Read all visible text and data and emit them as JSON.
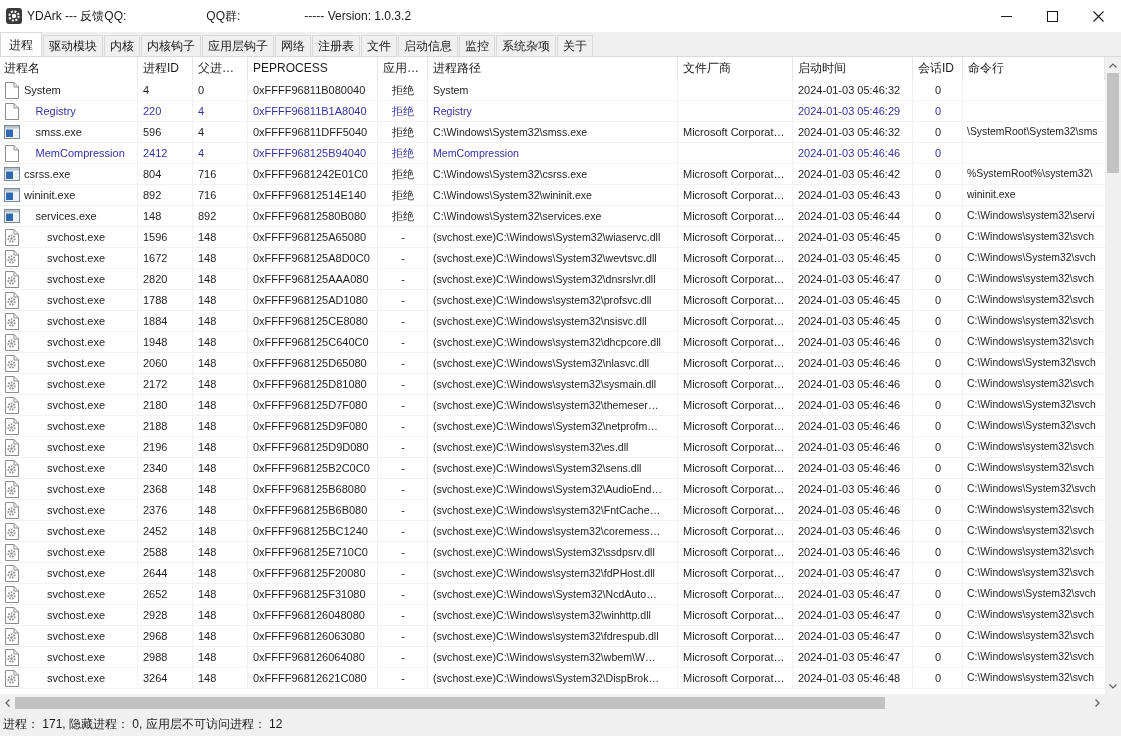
{
  "window": {
    "title_parts": [
      "YDArk --- 反馈QQ:",
      "QQ群:",
      "----- Version: 1.0.3.2"
    ]
  },
  "tabs": [
    {
      "label": "进程",
      "selected": true
    },
    {
      "label": "驱动模块",
      "selected": false
    },
    {
      "label": "内核",
      "selected": false
    },
    {
      "label": "内核钩子",
      "selected": false
    },
    {
      "label": "应用层钩子",
      "selected": false
    },
    {
      "label": "网络",
      "selected": false
    },
    {
      "label": "注册表",
      "selected": false
    },
    {
      "label": "文件",
      "selected": false
    },
    {
      "label": "启动信息",
      "selected": false
    },
    {
      "label": "监控",
      "selected": false
    },
    {
      "label": "系统杂项",
      "selected": false
    },
    {
      "label": "关于",
      "selected": false
    }
  ],
  "table": {
    "columns": [
      "进程名",
      "进程ID",
      "父进…",
      "PEPROCESS",
      "应用…",
      "进程路径",
      "文件厂商",
      "启动时间",
      "会话ID",
      "命令行"
    ],
    "rows": [
      {
        "kind": "file",
        "name": "System",
        "pid": "4",
        "ppid": "0",
        "peprocess": "0xFFFF96811B080040",
        "access": "拒绝",
        "path": "System",
        "start_time": "2024-01-03 05:46:32",
        "session": "0",
        "children": [
          {
            "kind": "file",
            "name": "Registry",
            "pid": "220",
            "ppid": "4",
            "peprocess": "0xFFFF96811B1A8040",
            "access": "拒绝",
            "path": "Registry",
            "start_time": "2024-01-03 05:46:29",
            "session": "0",
            "color": "#3333a0"
          },
          {
            "kind": "exe",
            "name": "smss.exe",
            "pid": "596",
            "ppid": "4",
            "peprocess": "0xFFFF96811DFF5040",
            "access": "拒绝",
            "path": "C:\\Windows\\System32\\smss.exe",
            "vendor": "Microsoft Corporat…",
            "start_time": "2024-01-03 05:46:32",
            "session": "0",
            "cmdline": "\\SystemRoot\\System32\\sms"
          },
          {
            "kind": "file",
            "name": "MemCompression",
            "pid": "2412",
            "ppid": "4",
            "peprocess": "0xFFFF968125B94040",
            "access": "拒绝",
            "path": "MemCompression",
            "start_time": "2024-01-03 05:46:46",
            "session": "0",
            "color": "#3333a0"
          }
        ]
      },
      {
        "kind": "exe",
        "name": "csrss.exe",
        "pid": "804",
        "ppid": "716",
        "peprocess": "0xFFFF9681242E01C0",
        "access": "拒绝",
        "path": "C:\\Windows\\System32\\csrss.exe",
        "vendor": "Microsoft Corporat…",
        "start_time": "2024-01-03 05:46:42",
        "session": "0",
        "cmdline": "%SystemRoot%\\system32\\"
      },
      {
        "kind": "exe",
        "name": "wininit.exe",
        "pid": "892",
        "ppid": "716",
        "peprocess": "0xFFFF96812514E140",
        "access": "拒绝",
        "path": "C:\\Windows\\System32\\wininit.exe",
        "vendor": "Microsoft Corporat…",
        "start_time": "2024-01-03 05:46:43",
        "session": "0",
        "cmdline": "wininit.exe",
        "children": [
          {
            "kind": "exe",
            "name": "services.exe",
            "pid": "148",
            "ppid": "892",
            "peprocess": "0xFFFF96812580B080",
            "access": "拒绝",
            "path": "C:\\Windows\\System32\\services.exe",
            "vendor": "Microsoft Corporat…",
            "start_time": "2024-01-03 05:46:44",
            "session": "0",
            "cmdline": "C:\\Windows\\system32\\servi",
            "children": [
              {
                "kind": "svc",
                "name": "svchost.exe",
                "pid": "1596",
                "ppid": "148",
                "peprocess": "0xFFFF968125A65080",
                "access": "-",
                "path": "(svchost.exe)C:\\Windows\\System32\\wiaservc.dll",
                "vendor": "Microsoft Corporat…",
                "start_time": "2024-01-03 05:46:45",
                "session": "0",
                "cmdline": "C:\\Windows\\system32\\svch"
              },
              {
                "kind": "svc",
                "name": "svchost.exe",
                "pid": "1672",
                "ppid": "148",
                "peprocess": "0xFFFF968125A8D0C0",
                "access": "-",
                "path": "(svchost.exe)C:\\Windows\\System32\\wevtsvc.dll",
                "vendor": "Microsoft Corporat…",
                "start_time": "2024-01-03 05:46:45",
                "session": "0",
                "cmdline": "C:\\Windows\\System32\\svch"
              },
              {
                "kind": "svc",
                "name": "svchost.exe",
                "pid": "2820",
                "ppid": "148",
                "peprocess": "0xFFFF968125AAA080",
                "access": "-",
                "path": "(svchost.exe)C:\\Windows\\System32\\dnsrslvr.dll",
                "vendor": "Microsoft Corporat…",
                "start_time": "2024-01-03 05:46:47",
                "session": "0",
                "cmdline": "C:\\Windows\\system32\\svch"
              },
              {
                "kind": "svc",
                "name": "svchost.exe",
                "pid": "1788",
                "ppid": "148",
                "peprocess": "0xFFFF968125AD1080",
                "access": "-",
                "path": "(svchost.exe)C:\\Windows\\system32\\profsvc.dll",
                "vendor": "Microsoft Corporat…",
                "start_time": "2024-01-03 05:46:45",
                "session": "0",
                "cmdline": "C:\\Windows\\system32\\svch"
              },
              {
                "kind": "svc",
                "name": "svchost.exe",
                "pid": "1884",
                "ppid": "148",
                "peprocess": "0xFFFF968125CE8080",
                "access": "-",
                "path": "(svchost.exe)C:\\Windows\\system32\\nsisvc.dll",
                "vendor": "Microsoft Corporat…",
                "start_time": "2024-01-03 05:46:45",
                "session": "0",
                "cmdline": "C:\\Windows\\system32\\svch"
              },
              {
                "kind": "svc",
                "name": "svchost.exe",
                "pid": "1948",
                "ppid": "148",
                "peprocess": "0xFFFF968125C640C0",
                "access": "-",
                "path": "(svchost.exe)C:\\Windows\\system32\\dhcpcore.dll",
                "vendor": "Microsoft Corporat…",
                "start_time": "2024-01-03 05:46:46",
                "session": "0",
                "cmdline": "C:\\Windows\\system32\\svch"
              },
              {
                "kind": "svc",
                "name": "svchost.exe",
                "pid": "2060",
                "ppid": "148",
                "peprocess": "0xFFFF968125D65080",
                "access": "-",
                "path": "(svchost.exe)C:\\Windows\\System32\\nlasvc.dll",
                "vendor": "Microsoft Corporat…",
                "start_time": "2024-01-03 05:46:46",
                "session": "0",
                "cmdline": "C:\\Windows\\System32\\svch"
              },
              {
                "kind": "svc",
                "name": "svchost.exe",
                "pid": "2172",
                "ppid": "148",
                "peprocess": "0xFFFF968125D81080",
                "access": "-",
                "path": "(svchost.exe)C:\\Windows\\system32\\sysmain.dll",
                "vendor": "Microsoft Corporat…",
                "start_time": "2024-01-03 05:46:46",
                "session": "0",
                "cmdline": "C:\\Windows\\system32\\svch"
              },
              {
                "kind": "svc",
                "name": "svchost.exe",
                "pid": "2180",
                "ppid": "148",
                "peprocess": "0xFFFF968125D7F080",
                "access": "-",
                "path": "(svchost.exe)C:\\Windows\\system32\\themeser…",
                "vendor": "Microsoft Corporat…",
                "start_time": "2024-01-03 05:46:46",
                "session": "0",
                "cmdline": "C:\\Windows\\System32\\svch"
              },
              {
                "kind": "svc",
                "name": "svchost.exe",
                "pid": "2188",
                "ppid": "148",
                "peprocess": "0xFFFF968125D9F080",
                "access": "-",
                "path": "(svchost.exe)C:\\Windows\\System32\\netprofm…",
                "vendor": "Microsoft Corporat…",
                "start_time": "2024-01-03 05:46:46",
                "session": "0",
                "cmdline": "C:\\Windows\\System32\\svch"
              },
              {
                "kind": "svc",
                "name": "svchost.exe",
                "pid": "2196",
                "ppid": "148",
                "peprocess": "0xFFFF968125D9D080",
                "access": "-",
                "path": "(svchost.exe)C:\\Windows\\system32\\es.dll",
                "vendor": "Microsoft Corporat…",
                "start_time": "2024-01-03 05:46:46",
                "session": "0",
                "cmdline": "C:\\Windows\\system32\\svch"
              },
              {
                "kind": "svc",
                "name": "svchost.exe",
                "pid": "2340",
                "ppid": "148",
                "peprocess": "0xFFFF968125B2C0C0",
                "access": "-",
                "path": "(svchost.exe)C:\\Windows\\System32\\sens.dll",
                "vendor": "Microsoft Corporat…",
                "start_time": "2024-01-03 05:46:46",
                "session": "0",
                "cmdline": "C:\\Windows\\system32\\svch"
              },
              {
                "kind": "svc",
                "name": "svchost.exe",
                "pid": "2368",
                "ppid": "148",
                "peprocess": "0xFFFF968125B68080",
                "access": "-",
                "path": "(svchost.exe)C:\\Windows\\System32\\AudioEnd…",
                "vendor": "Microsoft Corporat…",
                "start_time": "2024-01-03 05:46:46",
                "session": "0",
                "cmdline": "C:\\Windows\\System32\\svch"
              },
              {
                "kind": "svc",
                "name": "svchost.exe",
                "pid": "2376",
                "ppid": "148",
                "peprocess": "0xFFFF968125B6B080",
                "access": "-",
                "path": "(svchost.exe)C:\\Windows\\system32\\FntCache…",
                "vendor": "Microsoft Corporat…",
                "start_time": "2024-01-03 05:46:46",
                "session": "0",
                "cmdline": "C:\\Windows\\system32\\svch"
              },
              {
                "kind": "svc",
                "name": "svchost.exe",
                "pid": "2452",
                "ppid": "148",
                "peprocess": "0xFFFF968125BC1240",
                "access": "-",
                "path": "(svchost.exe)C:\\Windows\\system32\\coremess…",
                "vendor": "Microsoft Corporat…",
                "start_time": "2024-01-03 05:46:46",
                "session": "0",
                "cmdline": "C:\\Windows\\system32\\svch"
              },
              {
                "kind": "svc",
                "name": "svchost.exe",
                "pid": "2588",
                "ppid": "148",
                "peprocess": "0xFFFF968125E710C0",
                "access": "-",
                "path": "(svchost.exe)C:\\Windows\\System32\\ssdpsrv.dll",
                "vendor": "Microsoft Corporat…",
                "start_time": "2024-01-03 05:46:46",
                "session": "0",
                "cmdline": "C:\\Windows\\system32\\svch"
              },
              {
                "kind": "svc",
                "name": "svchost.exe",
                "pid": "2644",
                "ppid": "148",
                "peprocess": "0xFFFF968125F20080",
                "access": "-",
                "path": "(svchost.exe)C:\\Windows\\system32\\fdPHost.dll",
                "vendor": "Microsoft Corporat…",
                "start_time": "2024-01-03 05:46:47",
                "session": "0",
                "cmdline": "C:\\Windows\\system32\\svch"
              },
              {
                "kind": "svc",
                "name": "svchost.exe",
                "pid": "2652",
                "ppid": "148",
                "peprocess": "0xFFFF968125F31080",
                "access": "-",
                "path": "(svchost.exe)C:\\Windows\\System32\\NcdAuto…",
                "vendor": "Microsoft Corporat…",
                "start_time": "2024-01-03 05:46:47",
                "session": "0",
                "cmdline": "C:\\Windows\\System32\\svch"
              },
              {
                "kind": "svc",
                "name": "svchost.exe",
                "pid": "2928",
                "ppid": "148",
                "peprocess": "0xFFFF968126048080",
                "access": "-",
                "path": "(svchost.exe)C:\\Windows\\system32\\winhttp.dll",
                "vendor": "Microsoft Corporat…",
                "start_time": "2024-01-03 05:46:47",
                "session": "0",
                "cmdline": "C:\\Windows\\system32\\svch"
              },
              {
                "kind": "svc",
                "name": "svchost.exe",
                "pid": "2968",
                "ppid": "148",
                "peprocess": "0xFFFF968126063080",
                "access": "-",
                "path": "(svchost.exe)C:\\Windows\\system32\\fdrespub.dll",
                "vendor": "Microsoft Corporat…",
                "start_time": "2024-01-03 05:46:47",
                "session": "0",
                "cmdline": "C:\\Windows\\system32\\svch"
              },
              {
                "kind": "svc",
                "name": "svchost.exe",
                "pid": "2988",
                "ppid": "148",
                "peprocess": "0xFFFF968126064080",
                "access": "-",
                "path": "(svchost.exe)C:\\Windows\\system32\\wbem\\W…",
                "vendor": "Microsoft Corporat…",
                "start_time": "2024-01-03 05:46:47",
                "session": "0",
                "cmdline": "C:\\Windows\\system32\\svch"
              },
              {
                "kind": "svc",
                "name": "svchost.exe",
                "pid": "3264",
                "ppid": "148",
                "peprocess": "0xFFFF96812621C080",
                "access": "-",
                "path": "(svchost.exe)C:\\Windows\\System32\\DispBrok…",
                "vendor": "Microsoft Corporat…",
                "start_time": "2024-01-03 05:46:48",
                "session": "0",
                "cmdline": "C:\\Windows\\system32\\svch"
              }
            ]
          }
        ]
      }
    ]
  },
  "status_bar": {
    "text": "进程： 171, 隐藏进程： 0, 应用层不可访问进程： 12"
  }
}
